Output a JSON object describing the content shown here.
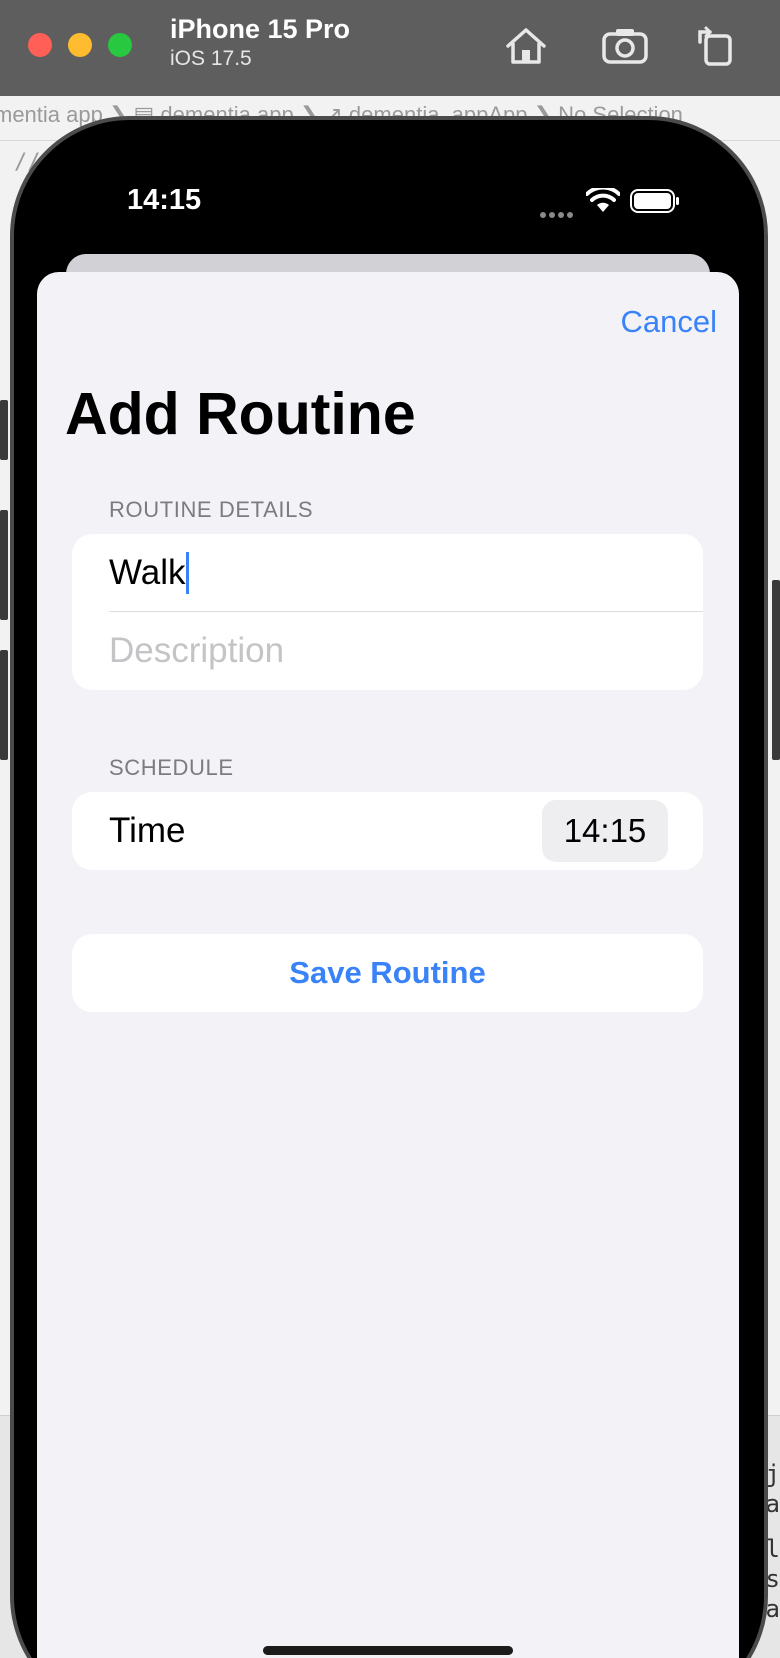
{
  "simulator": {
    "device_name": "iPhone 15 Pro",
    "os_version": "iOS 17.5",
    "icons": [
      "home-icon",
      "screenshot-icon",
      "rotate-icon"
    ]
  },
  "xcode": {
    "breadcrumb": "mentia app  ❯  ▤ dementia app  ❯  ↗ dementia_appApp  ❯  No Selection",
    "code_line": "//",
    "console_lines": [
      "j",
      "ra",
      "cl",
      "s",
      "ra"
    ]
  },
  "status_bar": {
    "time": "14:15",
    "icons": [
      "signal-dots-icon",
      "wifi-icon",
      "battery-icon"
    ]
  },
  "sheet": {
    "cancel_label": "Cancel",
    "title": "Add Routine",
    "routine_details": {
      "header": "ROUTINE DETAILS",
      "name_value": "Walk",
      "description_placeholder": "Description"
    },
    "schedule": {
      "header": "SCHEDULE",
      "time_label": "Time",
      "time_value": "14:15"
    },
    "save_label": "Save Routine"
  },
  "colors": {
    "accent": "#3a82f7",
    "sheet_background": "#f2f2f7",
    "titlebar": "#5e5e5e"
  }
}
